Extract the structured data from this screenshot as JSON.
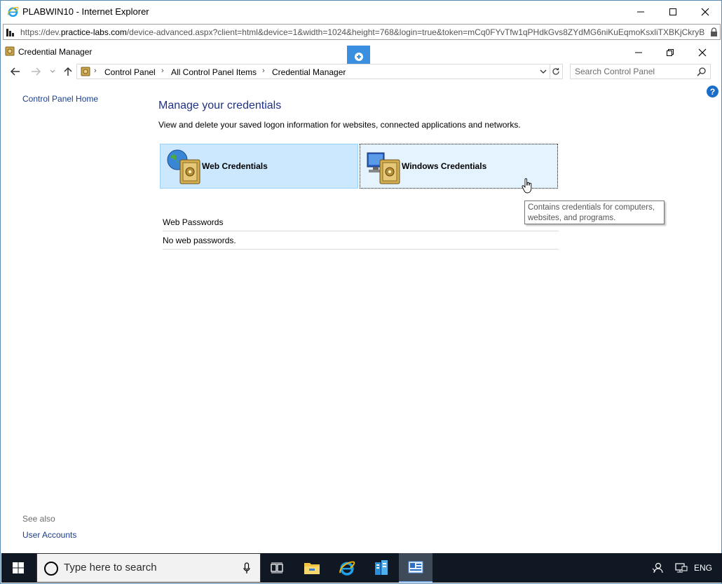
{
  "ie": {
    "title": "PLABWIN10 - Internet Explorer",
    "url_prefix": "https://dev.",
    "url_domain": "practice-labs.com",
    "url_rest": "/device-advanced.aspx?client=html&device=1&width=1024&height=768&login=true&token=mCq0FYvTfw1qPHdkGvs8ZYdMG6niKuEqmoKsxliTXBKjCkryB"
  },
  "window": {
    "title": "Credential Manager"
  },
  "breadcrumb": {
    "items": [
      "Control Panel",
      "All Control Panel Items",
      "Credential Manager"
    ]
  },
  "search": {
    "placeholder": "Search Control Panel"
  },
  "left_pane": {
    "home_link": "Control Panel Home",
    "see_also": "See also",
    "user_accounts": "User Accounts"
  },
  "main": {
    "heading": "Manage your credentials",
    "description": "View and delete your saved logon information for websites, connected applications and networks.",
    "tiles": [
      {
        "label": "Web Credentials",
        "selected": true,
        "icon": "globe-vault-icon"
      },
      {
        "label": "Windows Credentials",
        "selected": false,
        "icon": "computer-vault-icon"
      }
    ],
    "section_header": "Web Passwords",
    "empty_text": "No web passwords."
  },
  "tooltip": {
    "text": "Contains credentials for computers, websites, and programs."
  },
  "taskbar": {
    "search_placeholder": "Type here to search",
    "language": "ENG",
    "apps": [
      "task-view-icon",
      "file-explorer-icon",
      "internet-explorer-icon",
      "server-manager-icon",
      "credential-manager-icon"
    ]
  },
  "colors": {
    "accent": "#1e3287",
    "link": "#1a3f8c",
    "tile_selected": "#cce8ff",
    "tile_hover": "#e5f3ff",
    "taskbar": "#101823"
  }
}
